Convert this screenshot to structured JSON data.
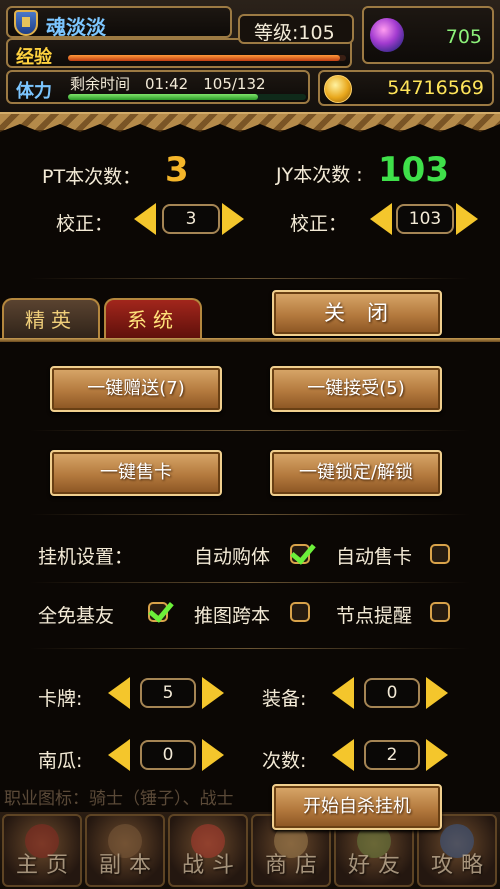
{
  "header": {
    "player_name": "魂淡淡",
    "level_label": "等级:105",
    "exp_label": "经验",
    "exp_progress": 0.98,
    "stamina_label": "体力",
    "stamina_text": "剩余时间　01:42　105/132",
    "stamina_progress": 0.8,
    "gems": "705",
    "gold": "54716569"
  },
  "counters": {
    "pt_label": "PT本次数：",
    "pt_value": "3",
    "jy_label": "JY本次数 :",
    "jy_value": "103",
    "adjust_label_1": "校正：",
    "adjust_value_1": "3",
    "adjust_label_2": "校正：",
    "adjust_value_2": "103"
  },
  "tabs": {
    "elite": "精英",
    "system": "系统",
    "close": "关闭"
  },
  "actions": {
    "gift_all": "一键赠送(7)",
    "accept_all": "一键接受(5)",
    "sell_cards": "一键售卡",
    "lock_unlock": "一键锁定/解锁"
  },
  "settings": {
    "auto_label": "挂机设置：",
    "auto_buy_stamina": "自动购体",
    "auto_buy_stamina_checked": true,
    "auto_sell_cards": "自动售卡",
    "auto_sell_cards_checked": false,
    "free_friends": "全免基友",
    "free_friends_checked": true,
    "push_cross": "推图跨本",
    "push_cross_checked": false,
    "node_remind": "节点提醒",
    "node_remind_checked": false
  },
  "limits": {
    "cards_label": "卡牌:",
    "cards_value": "5",
    "equip_label": "装备:",
    "equip_value": "0",
    "pumpkin_label": "南瓜:",
    "pumpkin_value": "0",
    "times_label": "次数:",
    "times_value": "2"
  },
  "start_button": "开始自杀挂机",
  "hint_text": "职业图标：骑士（锤子）、战士",
  "nav": [
    "主页",
    "副本",
    "战斗",
    "商店",
    "好友",
    "攻略"
  ],
  "colors": {
    "pt_value": "#f5b62a",
    "jy_value": "#3fe04a",
    "arrow": "#f4c62c",
    "check_on": "#6cf03a"
  }
}
